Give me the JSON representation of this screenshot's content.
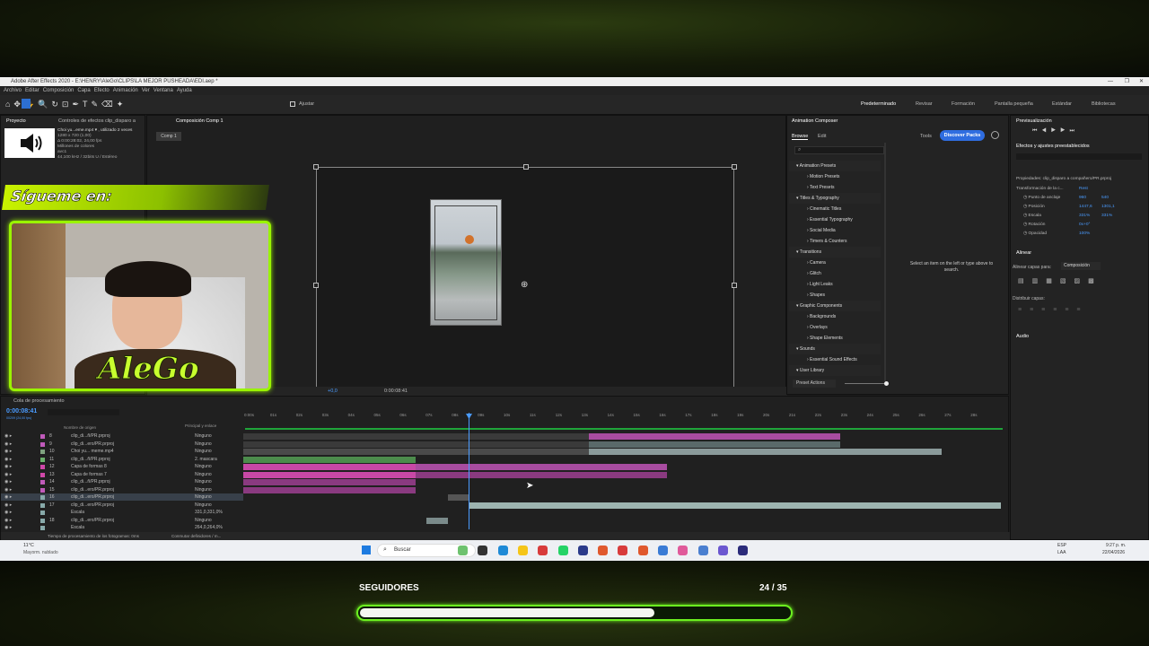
{
  "app": {
    "title": "Adobe After Effects 2020 - E:\\HENRY\\AleGo\\CLIPS\\LA MEJOR PUSHEADA\\EDI.aep *"
  },
  "menu": [
    "Archivo",
    "Editar",
    "Composición",
    "Capa",
    "Efecto",
    "Animación",
    "Ver",
    "Ventana",
    "Ayuda"
  ],
  "toolbar": {
    "snap_label": "Ajustar"
  },
  "workspaces": [
    "Predeterminado",
    "Revisar",
    "Formación",
    "Pantalla pequeña",
    "Estándar",
    "Bibliotecas"
  ],
  "project": {
    "tab": "Proyecto",
    "effects_tab": "Controles de efectos clip_disparo a",
    "file_name": "Choi yu...eme.mp4 ▾ , utilizado 2 veces",
    "res": "1280 x 720 (1,00)",
    "dur": "Δ 0:00:28:02, 24,00 fps",
    "colors": "Millones de colores",
    "codec": "avc1",
    "audio": "44,100 kHz / 32bits U / Estéreo",
    "list_item": "Choi yu yup - Wish meme.mp4"
  },
  "comp": {
    "tab": "Composición Comp 1",
    "sub_tab": "Comp 1",
    "timecode": "0:00:08:41",
    "zoom_value": "+0,0"
  },
  "anim_composer": {
    "title": "Animation Composer",
    "browse": "Browse",
    "edit": "Edit",
    "tools": "Tools",
    "discover": "Discover Packs",
    "hint": "Select an item on the left or type above to search.",
    "preset_actions": "Preset Actions",
    "tree": [
      "Animation Presets",
      "Motion Presets",
      "Text Presets",
      "Titles & Typography",
      "Cinematic Titles",
      "Essential Typography",
      "Social Media",
      "Timers & Counters",
      "Transitions",
      "Camera",
      "Glitch",
      "Light Leaks",
      "Shapes",
      "Graphic Components",
      "Backgrounds",
      "Overlays",
      "Shape Elements",
      "Sounds",
      "Essential Sound Effects",
      "User Library"
    ]
  },
  "right": {
    "preview": "Previsualización",
    "effects": "Efectos y ajustes preestablecidos",
    "props_title": "Propiedades: clip_disparo a compañero/PR.prproj",
    "transform": "Transformación de la c...",
    "reset": "Rest",
    "props": [
      {
        "name": "Punto de anclaje",
        "v1": "960",
        "v2": "540"
      },
      {
        "name": "Posición",
        "v1": "1447,6",
        "v2": "1301,1"
      },
      {
        "name": "Escala",
        "v1": "331%",
        "v2": "331%"
      },
      {
        "name": "Rotación",
        "v1": "0x+0°",
        "v2": ""
      },
      {
        "name": "Opacidad",
        "v1": "100%",
        "v2": ""
      }
    ],
    "align": "Alinear",
    "align_to": "Alinear capas para:",
    "align_value": "Composición",
    "distribute": "Distribuir capas:",
    "audio": "Audio"
  },
  "timeline": {
    "render_queue": "Cola de procesamiento",
    "timecode": "0:00:08:41",
    "fps_note": "00209 (24,00 fps)",
    "col_name": "Nombre de origen",
    "col_parent": "Principal y enlace",
    "ticks": [
      "0:00s",
      "01s",
      "02s",
      "03s",
      "04s",
      "05s",
      "06s",
      "07s",
      "08s",
      "09s",
      "10s",
      "11s",
      "12s",
      "13s",
      "14s",
      "15s",
      "16s",
      "17s",
      "18s",
      "19s",
      "20s",
      "21s",
      "22s",
      "23s",
      "24s",
      "25s",
      "26s",
      "27s",
      "28s"
    ],
    "layers": [
      {
        "num": "8",
        "name": "clip_di...ñ/PR.prproj",
        "parent": "Ninguno"
      },
      {
        "num": "9",
        "name": "clip_di...ero/PR.prproj",
        "parent": "Ninguno"
      },
      {
        "num": "10",
        "name": "Choi yu... meme.mp4",
        "parent": "Ninguno"
      },
      {
        "num": "11",
        "name": "clip_di...ñ/PR.prproj",
        "parent": "2. mascara"
      },
      {
        "num": "12",
        "name": "Capa de formas 8",
        "parent": "Ninguno"
      },
      {
        "num": "13",
        "name": "Capa de formas 7",
        "parent": "Ninguno"
      },
      {
        "num": "14",
        "name": "clip_di...ñ/PR.prproj",
        "parent": "Ninguno"
      },
      {
        "num": "15",
        "name": "clip_di...ero/PR.prproj",
        "parent": "Ninguno"
      },
      {
        "num": "16",
        "name": "clip_di...ero/PR.prproj",
        "parent": "Ninguno"
      },
      {
        "num": "17",
        "name": "clip_di...ero/PR.prproj",
        "parent": "Ninguno"
      },
      {
        "num": "",
        "name": "Escala",
        "parent": "331,0,331,0%"
      },
      {
        "num": "18",
        "name": "clip_di...ero/PR.prproj",
        "parent": "Ninguno"
      },
      {
        "num": "",
        "name": "Escala",
        "parent": "264,0,264,0%"
      }
    ],
    "footer_time": "Tiempo de procesamiento de los fotogramas: 0ms",
    "footer_switch": "Conmutar definidores / m..."
  },
  "taskbar": {
    "weather_temp": "11°C",
    "weather_desc": "Mayorm. nublado",
    "search": "Buscar",
    "lang": "ESP",
    "lang2": "LAA",
    "time": "9:27 p. m.",
    "date": "22/04/2026"
  },
  "overlay": {
    "follow_label": "Síguemе en:",
    "streamer": "AleGo",
    "followers_label": "SEGUIDORES",
    "followers_count": "24 / 35",
    "progress": 0.686
  }
}
